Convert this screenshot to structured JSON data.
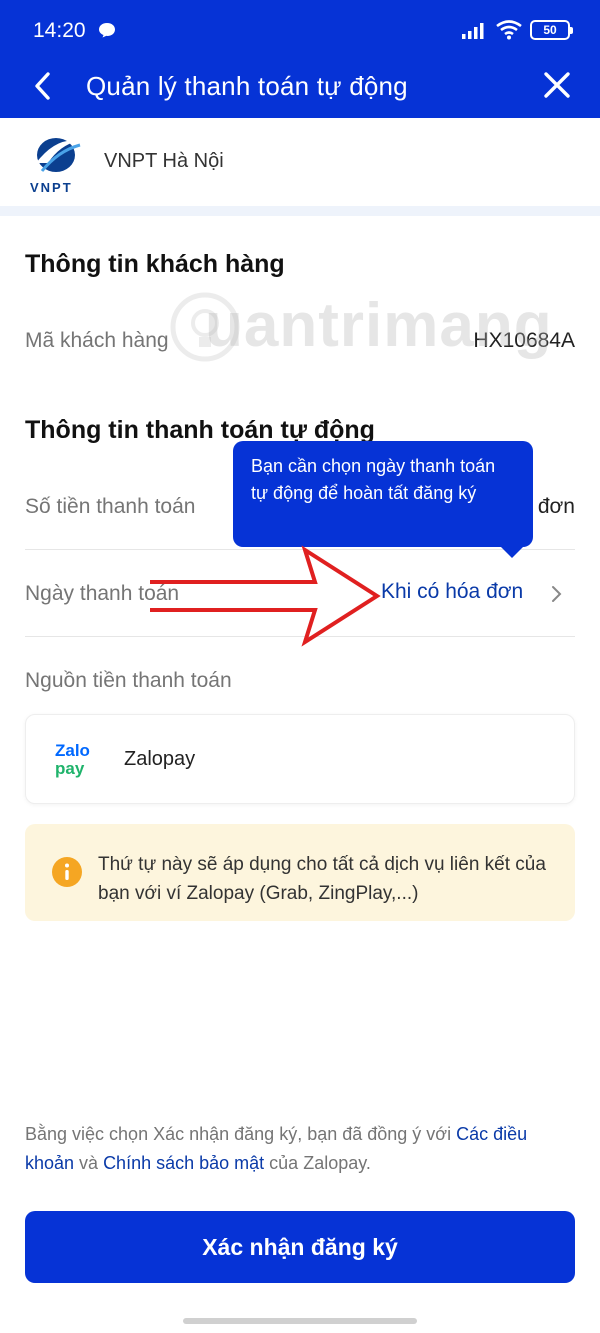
{
  "status_bar": {
    "time": "14:20",
    "battery": "50"
  },
  "nav": {
    "title": "Quản lý thanh toán tự động"
  },
  "merchant": {
    "logo_text": "VNPT",
    "name": "VNPT Hà Nội"
  },
  "customer_info": {
    "title": "Thông tin khách hàng",
    "customer_code_label": "Mã khách hàng",
    "customer_code_value": "HX10684A"
  },
  "payment_info": {
    "title": "Thông tin thanh toán tự động",
    "amount_label": "Số tiền thanh toán",
    "amount_value": "đơn",
    "date_label": "Ngày thanh toán",
    "date_value": "Khi có hóa đơn",
    "source_label": "Nguồn tiền thanh toán"
  },
  "tooltip": {
    "text": "Bạn cần chọn ngày thanh toán tự động để hoàn tất đăng ký"
  },
  "source": {
    "logo_line1": "Zalo",
    "logo_line2": "pay",
    "name": "Zalopay"
  },
  "notice": {
    "text": "Thứ tự này sẽ áp dụng cho tất cả dịch vụ liên kết của bạn với ví Zalopay (Grab, ZingPlay,...)"
  },
  "terms": {
    "prefix": "Bằng việc chọn Xác nhận đăng ký, bạn đã đồng ý với ",
    "link1": "Các điều khoản",
    "middle": " và ",
    "link2": "Chính sách bảo mật",
    "suffix": " của Zalopay."
  },
  "cta": {
    "label": "Xác nhận đăng ký"
  },
  "watermark": {
    "text": "uantrimang"
  },
  "colors": {
    "primary": "#0633d6",
    "link": "#0a3aa8",
    "notice_bg": "#fdf5dd",
    "info_icon": "#f5a623",
    "zalo_blue": "#0068ff",
    "zalo_green": "#1fb36b",
    "annotation_red": "#e02020"
  }
}
